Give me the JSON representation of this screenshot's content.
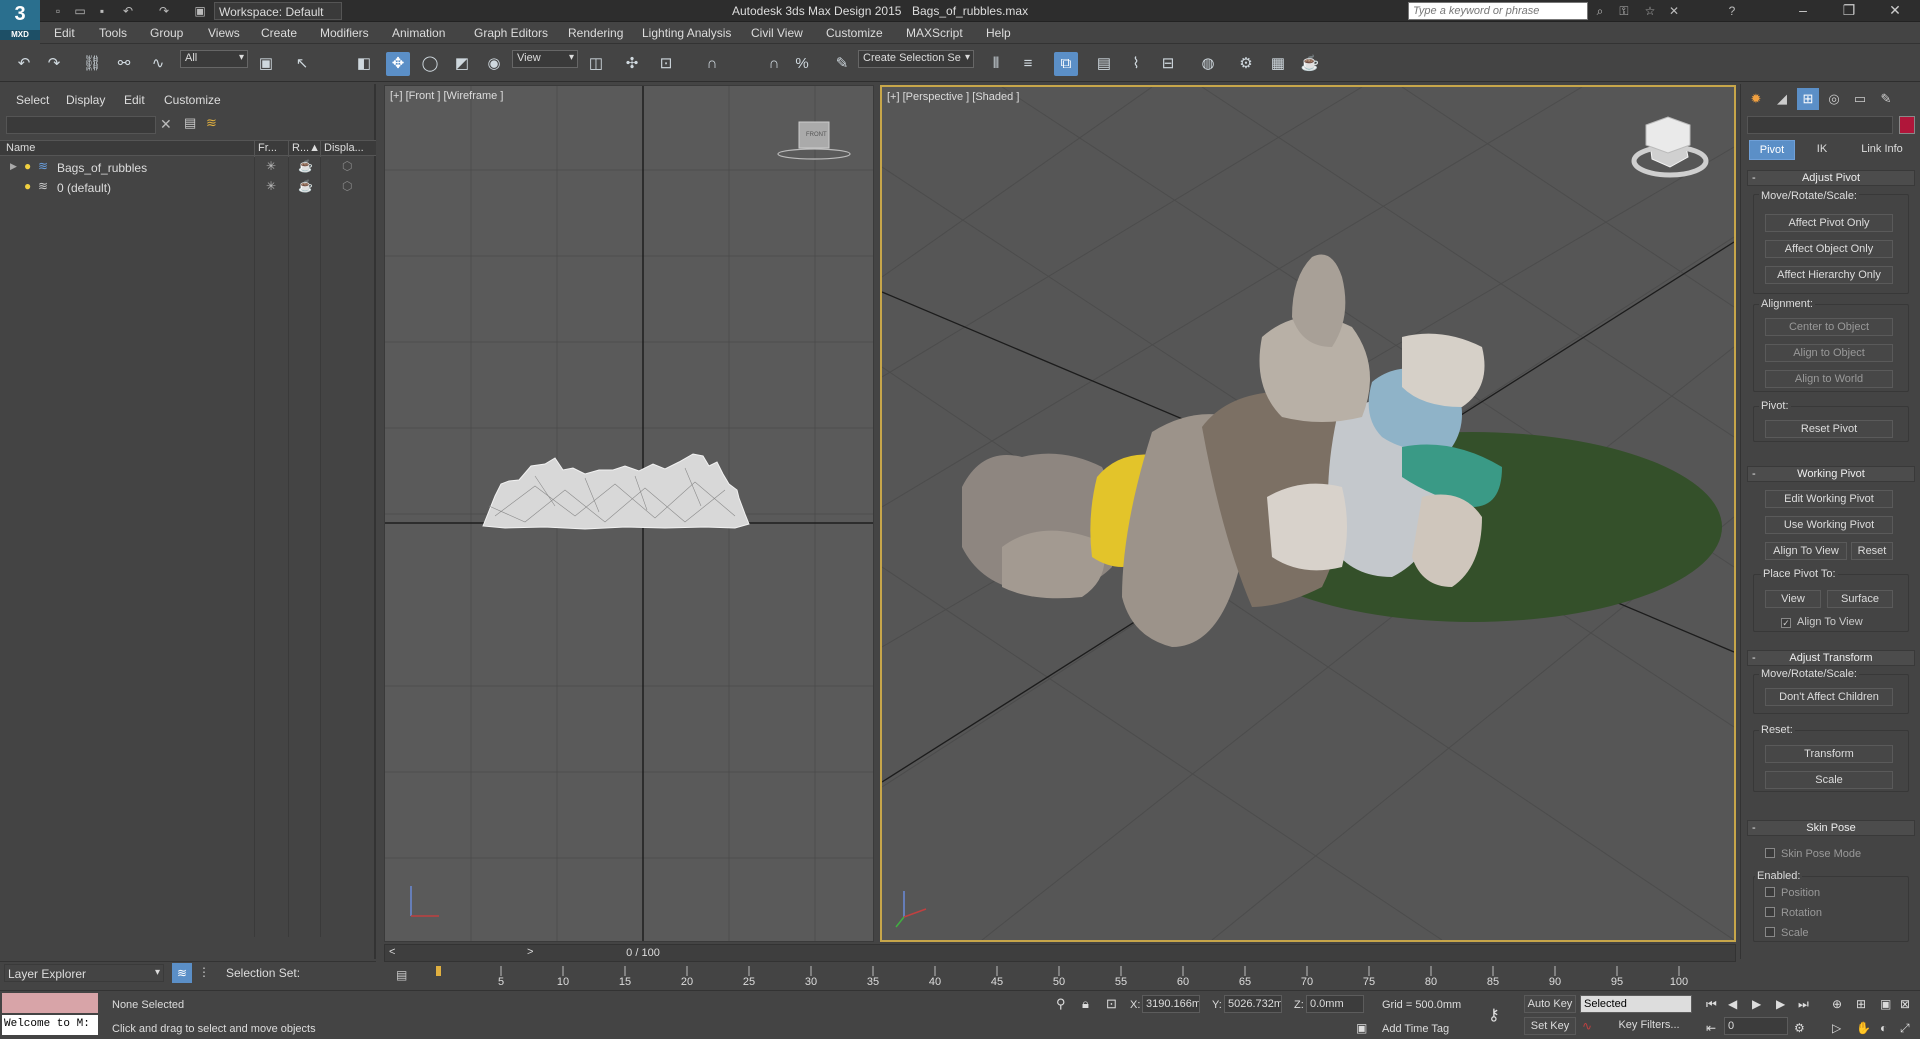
{
  "app": {
    "logo_text": "MXD",
    "title": "Autodesk 3ds Max Design 2015",
    "filename": "Bags_of_rubbles.max",
    "workspace": "Workspace: Default",
    "search_placeholder": "Type a keyword or phrase"
  },
  "menu": [
    "Edit",
    "Tools",
    "Group",
    "Views",
    "Create",
    "Modifiers",
    "Animation",
    "Graph Editors",
    "Rendering",
    "Lighting Analysis",
    "Civil View",
    "Customize",
    "MAXScript",
    "Help"
  ],
  "toolbar": {
    "selection_filter": "All",
    "ref_coord": "View",
    "named_selection": "Create Selection Se"
  },
  "scene_explorer": {
    "menu": [
      "Select",
      "Display",
      "Edit",
      "Customize"
    ],
    "columns": [
      "Name",
      "Fr...",
      "R...▲",
      "Displa..."
    ],
    "rows": [
      {
        "name": "Bags_of_rubbles"
      },
      {
        "name": "0 (default)"
      }
    ],
    "footer_label": "Layer Explorer",
    "selection_set_label": "Selection Set:"
  },
  "viewports": {
    "front_label": "[+] [Front ] [Wireframe ]",
    "persp_label": "[+] [Perspective ] [Shaded ]",
    "viewcube_label": "FRONT"
  },
  "timeline": {
    "frame_display": "0 / 100",
    "prev": "<",
    "next": ">",
    "ticks": [
      "5",
      "10",
      "15",
      "20",
      "25",
      "30",
      "35",
      "40",
      "45",
      "50",
      "55",
      "60",
      "65",
      "70",
      "75",
      "80",
      "85",
      "90",
      "95",
      "100"
    ]
  },
  "command_panel": {
    "tabs": [
      "Pivot",
      "IK",
      "Link Info"
    ],
    "adjust_pivot": {
      "title": "Adjust Pivot",
      "move_label": "Move/Rotate/Scale:",
      "buttons": [
        "Affect Pivot Only",
        "Affect Object Only",
        "Affect Hierarchy Only"
      ],
      "alignment_label": "Alignment:",
      "align_buttons": [
        "Center to Object",
        "Align to Object",
        "Align to World"
      ],
      "pivot_label": "Pivot:",
      "reset_pivot": "Reset Pivot"
    },
    "working_pivot": {
      "title": "Working Pivot",
      "edit": "Edit Working Pivot",
      "use": "Use Working Pivot",
      "align_to_view": "Align To View",
      "reset": "Reset",
      "place_label": "Place Pivot To:",
      "view": "View",
      "surface": "Surface",
      "align_check": "Align To View"
    },
    "adjust_transform": {
      "title": "Adjust Transform",
      "move_label": "Move/Rotate/Scale:",
      "dont_affect": "Don't Affect Children",
      "reset_label": "Reset:",
      "transform": "Transform",
      "scale": "Scale"
    },
    "skin_pose": {
      "title": "Skin Pose",
      "mode": "Skin Pose Mode",
      "enabled_label": "Enabled:",
      "position": "Position",
      "rotation": "Rotation",
      "scale": "Scale"
    }
  },
  "status": {
    "listener": "Welcome to M:",
    "selection": "None Selected",
    "prompt": "Click and drag to select and move objects",
    "x_label": "X:",
    "x_val": "3190.166m",
    "y_label": "Y:",
    "y_val": "5026.732m",
    "z_label": "Z:",
    "z_val": "0.0mm",
    "grid": "Grid = 500.0mm",
    "add_time_tag": "Add Time Tag",
    "auto_key": "Auto Key",
    "set_key": "Set Key",
    "key_mode": "Selected",
    "key_filters": "Key Filters...",
    "frame": "0"
  }
}
